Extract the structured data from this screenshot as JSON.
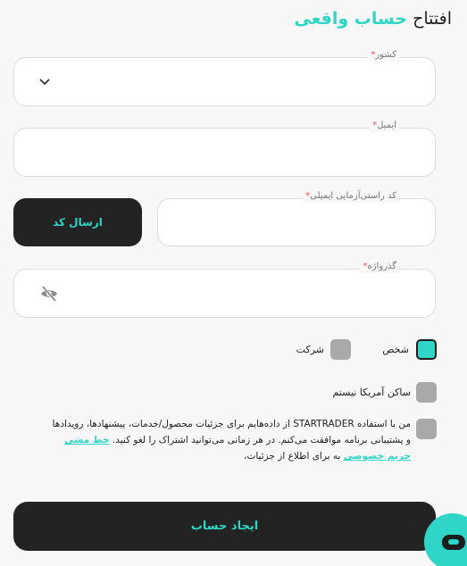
{
  "header": {
    "title_part1": "افتتاح",
    "title_part2": "حساب واقعی"
  },
  "form": {
    "country": {
      "label": "کشور",
      "required_mark": "*",
      "value": ""
    },
    "email": {
      "label": "ایمیل",
      "required_mark": "*",
      "value": ""
    },
    "verification": {
      "label": "کد راستی‌آزمایی ایمیلی",
      "required_mark": "*",
      "value": "",
      "send_label": "ارسال کد"
    },
    "password": {
      "label": "گذرواژه",
      "required_mark": "*",
      "value": ""
    },
    "account_type": {
      "options": [
        {
          "label": "شخص",
          "selected": true
        },
        {
          "label": "شرکت",
          "selected": false
        }
      ]
    },
    "us_resident": {
      "label": "ساکن آمریکا نیستم",
      "checked": false
    },
    "consent": {
      "text_before": "من با استفاده STARTRADER از داده‌هایم برای جزئیات محصول/خدمات، پیشنهادها، رویدادها و پشتیبانی برنامه موافقت می‌کنم. در هر زمانی می‌توانید اشتراک را لغو کنید. ",
      "link": "خط مشی حریم خصوصی",
      "text_after": " به برای اطلاع از جزئیات،",
      "checked": false
    },
    "submit_label": "ایجاد حساب"
  },
  "colors": {
    "accent": "#2fd6c7",
    "dark": "#232323",
    "required": "#ff4d4d"
  },
  "icons": {
    "country_dropdown": "chevron-down-icon",
    "password_toggle": "eye-off-icon",
    "chat": "chat-icon"
  }
}
